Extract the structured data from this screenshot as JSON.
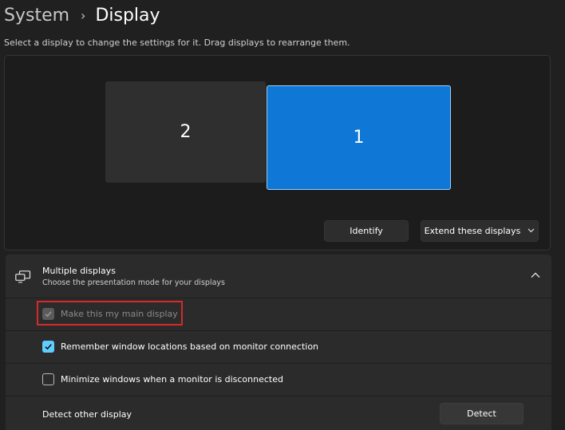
{
  "breadcrumb": {
    "parent": "System",
    "separator": "›",
    "current": "Display"
  },
  "instructions": "Select a display to change the settings for it. Drag displays to rearrange them.",
  "arrangement": {
    "monitors": [
      {
        "number": "2",
        "selected": false
      },
      {
        "number": "1",
        "selected": true
      }
    ],
    "identify_label": "Identify",
    "mode_select": {
      "value": "Extend these displays",
      "icon": "chevron-down-icon"
    }
  },
  "multiple_displays": {
    "icon": "multiple-monitors-icon",
    "title": "Multiple displays",
    "subtitle": "Choose the presentation mode for your displays",
    "expanded": true,
    "options": [
      {
        "label": "Make this my main display",
        "checked": true,
        "disabled": true
      },
      {
        "label": "Remember window locations based on monitor connection",
        "checked": true,
        "disabled": false
      },
      {
        "label": "Minimize windows when a monitor is disconnected",
        "checked": false,
        "disabled": false
      }
    ],
    "detect": {
      "label": "Detect other display",
      "button": "Detect"
    }
  },
  "colors": {
    "accent": "#60cdff",
    "selected_monitor": "#0f78d7",
    "highlight": "#d42a2a",
    "background": "#202020",
    "card": "#2b2b2b"
  }
}
